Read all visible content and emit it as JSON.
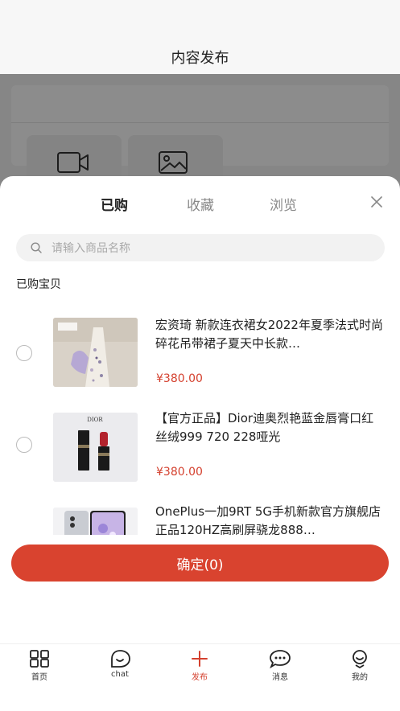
{
  "header": {
    "title": "内容发布"
  },
  "sheet": {
    "tabs": [
      {
        "label": "已购",
        "active": true
      },
      {
        "label": "收藏",
        "active": false
      },
      {
        "label": "浏览",
        "active": false
      }
    ],
    "search": {
      "placeholder": "请输入商品名称",
      "value": ""
    },
    "section_label": "已购宝贝",
    "items": [
      {
        "title": "宏资琦 新款连衣裙女2022年夏季法式时尚碎花吊带裙子夏天中长款…",
        "price": "¥380.00",
        "selected": false
      },
      {
        "title": "【官方正品】Dior迪奥烈艳蓝金唇膏口红 丝绒999 720 228哑光",
        "price": "¥380.00",
        "selected": false,
        "brand_text": "DIOR"
      },
      {
        "title": "OnePlus一加9RT 5G手机新款官方旗舰店正品120HZ高刷屏骁龙888…",
        "price": "",
        "selected": false
      }
    ],
    "confirm_label": "确定(0)"
  },
  "nav": {
    "items": [
      {
        "label": "首页",
        "icon": "grid-icon"
      },
      {
        "label": "chat",
        "icon": "chat-bubble-icon"
      },
      {
        "label": "发布",
        "icon": "plus-icon",
        "active": true
      },
      {
        "label": "消息",
        "icon": "message-icon"
      },
      {
        "label": "我的",
        "icon": "profile-icon"
      }
    ]
  },
  "colors": {
    "accent": "#d9432f",
    "price": "#d4402e"
  }
}
